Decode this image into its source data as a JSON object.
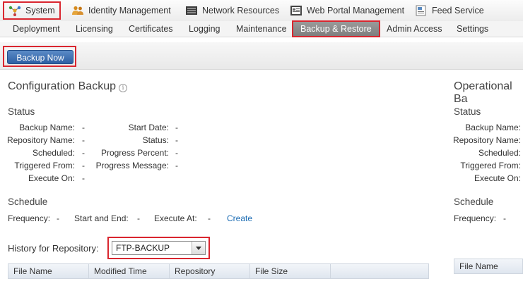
{
  "topnav": {
    "items": [
      {
        "label": "System",
        "icon": "system-icon"
      },
      {
        "label": "Identity Management",
        "icon": "people-icon"
      },
      {
        "label": "Network Resources",
        "icon": "network-device-icon"
      },
      {
        "label": "Web Portal Management",
        "icon": "portal-icon"
      },
      {
        "label": "Feed Service",
        "icon": "feed-icon"
      }
    ]
  },
  "subnav": {
    "tabs": [
      "Deployment",
      "Licensing",
      "Certificates",
      "Logging",
      "Maintenance",
      "Backup & Restore",
      "Admin Access",
      "Settings"
    ],
    "active": "Backup & Restore"
  },
  "toolbar": {
    "backup_now": "Backup Now"
  },
  "config_backup": {
    "title": "Configuration Backup",
    "status_heading": "Status",
    "left_fields": [
      {
        "label": "Backup Name:",
        "value": "-"
      },
      {
        "label": "Repository Name:",
        "value": "-"
      },
      {
        "label": "Scheduled:",
        "value": "-"
      },
      {
        "label": "Triggered From:",
        "value": "-"
      },
      {
        "label": "Execute On:",
        "value": "-"
      }
    ],
    "right_fields": [
      {
        "label": "Start Date:",
        "value": "-"
      },
      {
        "label": "Status:",
        "value": "-"
      },
      {
        "label": "Progress Percent:",
        "value": "-"
      },
      {
        "label": "Progress Message:",
        "value": "-"
      }
    ],
    "schedule_heading": "Schedule",
    "schedule": {
      "frequency_label": "Frequency:",
      "frequency_value": "-",
      "start_end_label": "Start and End:",
      "start_end_value": "-",
      "execute_at_label": "Execute At:",
      "execute_at_value": "-",
      "create_link": "Create"
    },
    "history_label": "History for Repository:",
    "repository_selected": "FTP-BACKUP",
    "columns": [
      "File Name",
      "Modified Time",
      "Repository",
      "File Size"
    ]
  },
  "operational_backup": {
    "title": "Operational Ba",
    "status_heading": "Status",
    "fields": [
      {
        "label": "Backup Name:"
      },
      {
        "label": "Repository Name:"
      },
      {
        "label": "Scheduled:"
      },
      {
        "label": "Triggered From:"
      },
      {
        "label": "Execute On:"
      }
    ],
    "schedule_heading": "Schedule",
    "frequency_label": "Frequency:",
    "frequency_value": "-",
    "column": "File Name"
  }
}
